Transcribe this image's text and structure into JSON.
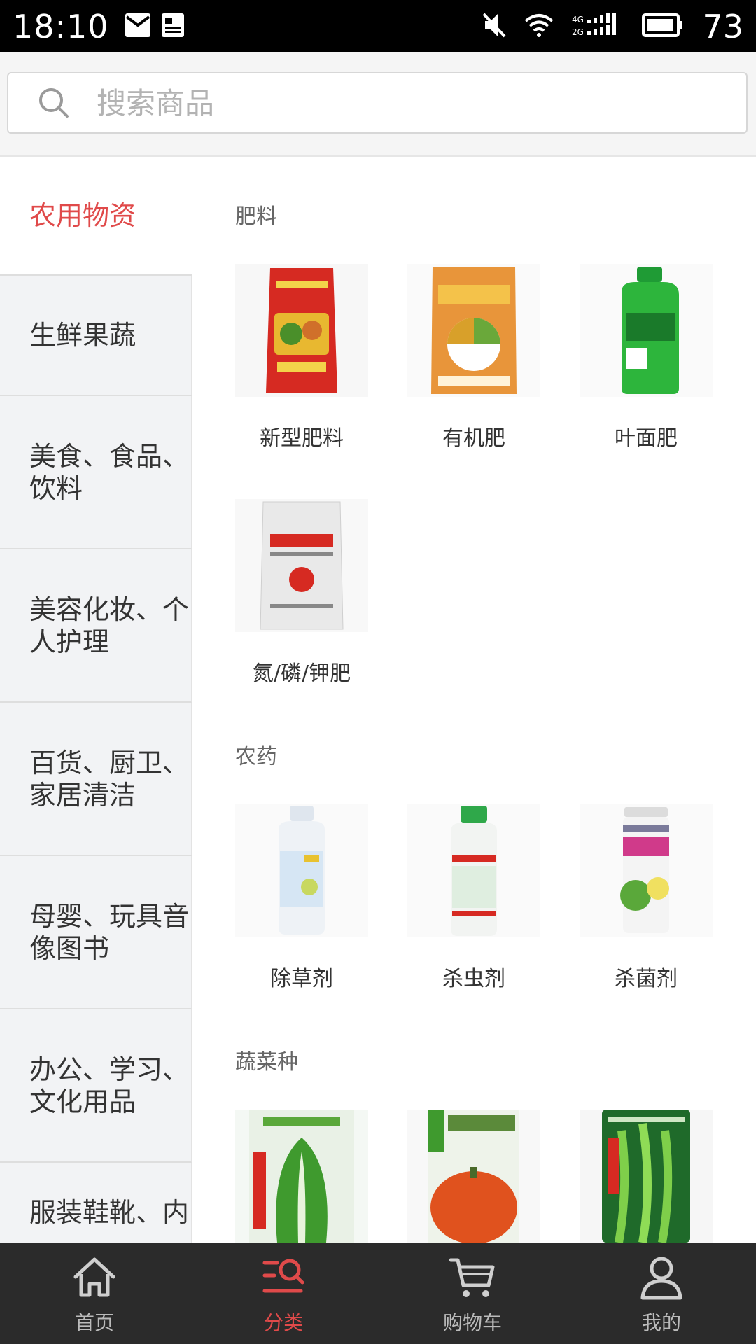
{
  "status_bar": {
    "time": "18:10",
    "battery": "73",
    "icons": [
      "mail-icon",
      "news-icon",
      "mute-icon",
      "wifi-icon",
      "signal-4g-2g-icon",
      "battery-icon"
    ]
  },
  "search": {
    "placeholder": "搜索商品"
  },
  "sidebar": {
    "items": [
      {
        "lines": [
          "农用物资"
        ],
        "active": true
      },
      {
        "lines": [
          "生鲜果蔬"
        ]
      },
      {
        "lines": [
          "美食、食品、",
          "饮料"
        ]
      },
      {
        "lines": [
          "美容化妆、个",
          "人护理"
        ]
      },
      {
        "lines": [
          "百货、厨卫、",
          "家居清洁"
        ]
      },
      {
        "lines": [
          "母婴、玩具音",
          "像图书"
        ]
      },
      {
        "lines": [
          "办公、学习、",
          "文化用品"
        ]
      },
      {
        "lines": [
          "服装鞋靴、内"
        ]
      }
    ]
  },
  "sections": [
    {
      "title": "肥料",
      "products": [
        "新型肥料",
        "有机肥",
        "叶面肥",
        "氮/磷/钾肥"
      ]
    },
    {
      "title": "农药",
      "products": [
        "除草剂",
        "杀虫剂",
        "杀菌剂"
      ]
    },
    {
      "title": "蔬菜种",
      "products": [
        "",
        "",
        ""
      ]
    }
  ],
  "bottom_nav": [
    {
      "label": "首页",
      "icon": "home-icon"
    },
    {
      "label": "分类",
      "icon": "category-icon",
      "active": true
    },
    {
      "label": "购物车",
      "icon": "cart-icon"
    },
    {
      "label": "我的",
      "icon": "profile-icon"
    }
  ],
  "colors": {
    "accent": "#e04a4a",
    "nav_bg": "#2b2b2b",
    "sidebar_bg": "#f2f3f5"
  }
}
